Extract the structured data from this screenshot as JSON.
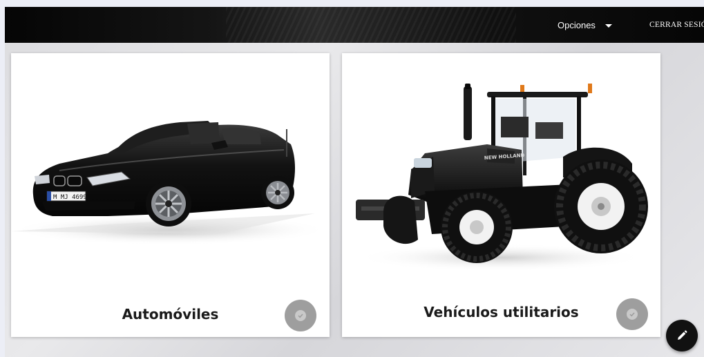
{
  "navbar": {
    "options_label": "Opciones",
    "logout_label": "CERRAR SESIÓN"
  },
  "cards": [
    {
      "title": "Automóviles",
      "plate": "M MJ 4699"
    },
    {
      "title": "Vehículos utilitarios",
      "brand": "NEW HOLLAND"
    }
  ],
  "colors": {
    "navbar_bg": "#0b0b0b",
    "card_bg": "#ffffff",
    "check_button": "#9e9e9e",
    "fab_bg": "#111111"
  },
  "icons": {
    "options_dropdown": "chevron-down-icon",
    "card_check": "check-circle-icon",
    "fab": "pencil-icon"
  }
}
